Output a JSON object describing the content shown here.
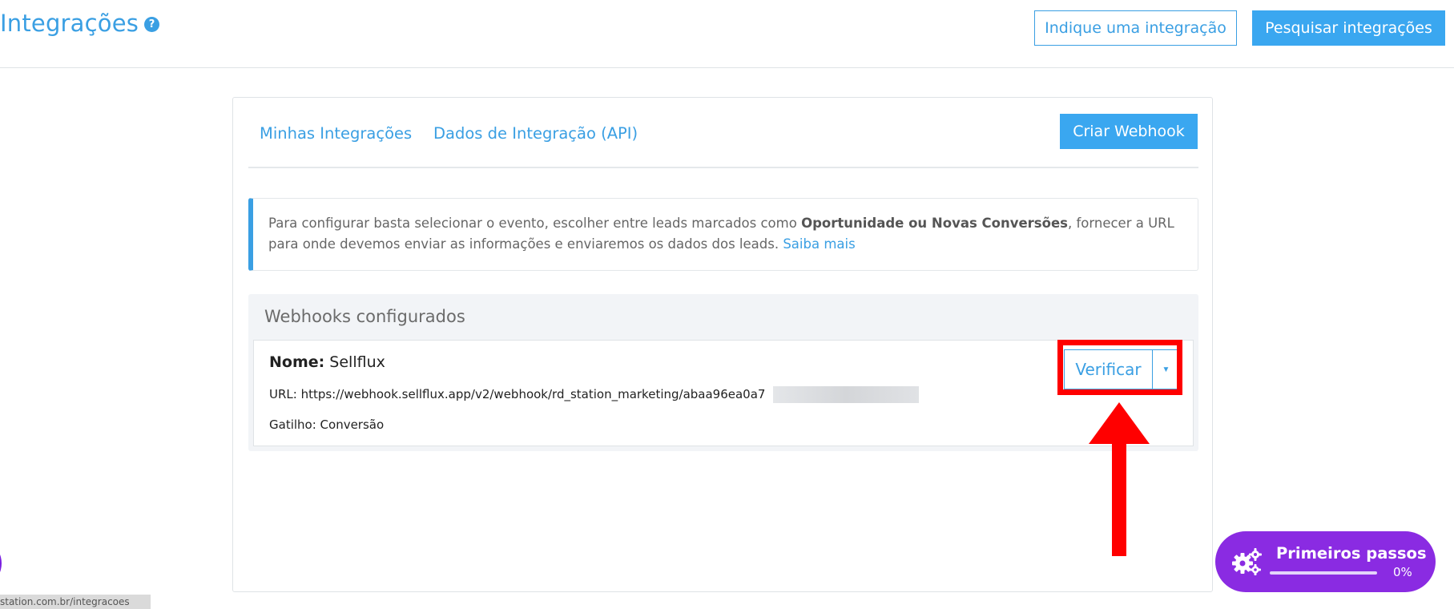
{
  "header": {
    "title": "Integrações",
    "help_icon": "question-circle-icon",
    "suggest_button": "Indique uma integração",
    "search_button": "Pesquisar integrações"
  },
  "card": {
    "tabs": [
      {
        "label": "Minhas Integrações"
      },
      {
        "label": "Dados de Integração (API)"
      }
    ],
    "create_button": "Criar Webhook"
  },
  "info": {
    "text_before": "Para configurar basta selecionar o evento, escolher entre leads marcados como ",
    "text_bold": "Oportunidade ou Novas Conversões",
    "text_after": ", fornecer a URL para onde devemos enviar as informações e enviaremos os dados dos leads. ",
    "link": "Saiba mais"
  },
  "webhooks": {
    "title": "Webhooks configurados",
    "items": [
      {
        "name_label": "Nome:",
        "name": "Sellflux",
        "url": "URL: https://webhook.sellflux.app/v2/webhook/rd_station_marketing/abaa96ea0a7",
        "trigger": "Gatilho: Conversão",
        "verify_button": "Verificar",
        "dropdown_icon": "caret-down-icon"
      }
    ]
  },
  "onboarding": {
    "label": "Primeiros passos",
    "progress_text": "0%",
    "progress": 0,
    "icon": "gears-icon"
  },
  "status_bar": {
    "url": "station.com.br/integracoes"
  },
  "colors": {
    "primary": "#3a9fe3",
    "button_fill": "#3aa7f0",
    "annotation": "#ff0000",
    "widget": "#8a2be2"
  }
}
